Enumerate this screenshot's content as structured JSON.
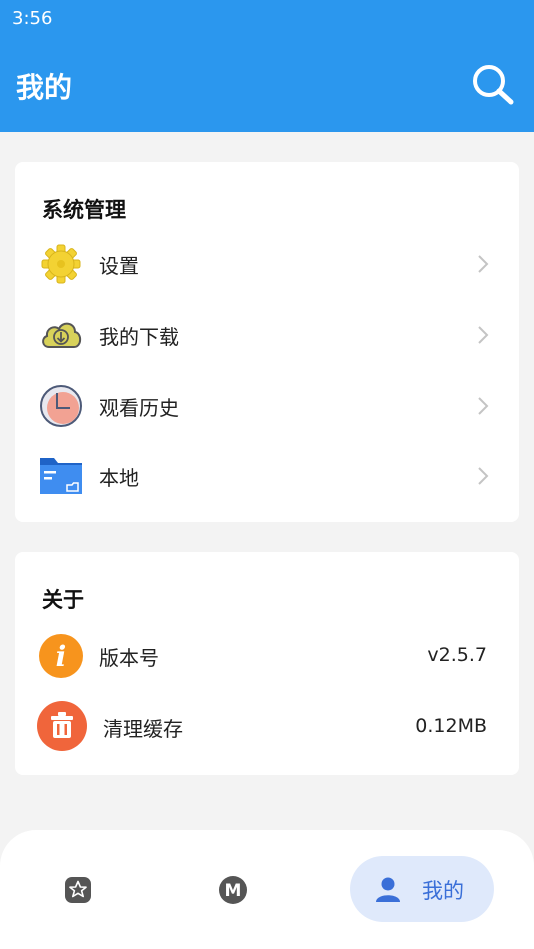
{
  "status_bar": {
    "time": "3:56"
  },
  "header": {
    "title": "我的",
    "search_icon": "search-icon"
  },
  "colors": {
    "primary": "#2b97ee",
    "page_bg": "#f3f3f3",
    "nav_active_bg": "#dfe9fb",
    "nav_active_text": "#3a6fd8"
  },
  "system_section": {
    "title": "系统管理",
    "items": [
      {
        "label": "设置",
        "icon": "gear-icon"
      },
      {
        "label": "我的下载",
        "icon": "cloud-download-icon"
      },
      {
        "label": "观看历史",
        "icon": "clock-icon"
      },
      {
        "label": "本地",
        "icon": "folder-icon"
      }
    ]
  },
  "about_section": {
    "title": "关于",
    "items": [
      {
        "label": "版本号",
        "value": "v2.5.7",
        "icon": "info-icon"
      },
      {
        "label": "清理缓存",
        "value": "0.12MB",
        "icon": "trash-icon"
      }
    ]
  },
  "bottom_nav": {
    "items": [
      {
        "icon": "star-icon"
      },
      {
        "icon": "m-logo-icon"
      },
      {
        "icon": "person-icon",
        "label": "我的",
        "active": true
      }
    ]
  }
}
